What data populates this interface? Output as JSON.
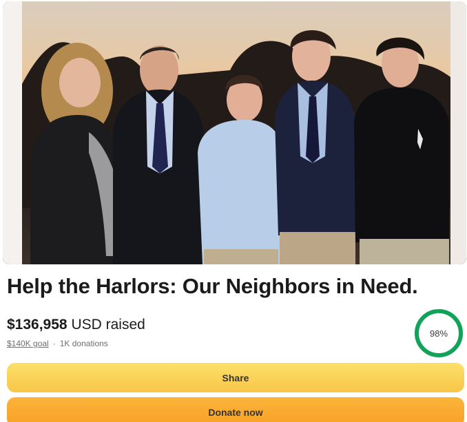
{
  "campaign": {
    "title": "Help the Harlors: Our Neighbors in Need.",
    "raised_amount": "$136,958",
    "raised_unit": "USD raised",
    "goal": "$140K goal",
    "separator": "·",
    "donations": "1K donations",
    "progress_label": "98%",
    "progress_fraction": 0.98
  },
  "buttons": {
    "share_label": "Share",
    "donate_label": "Donate now"
  },
  "colors": {
    "progress": "#12a35a",
    "share_button": "#fbd35a",
    "donate_button": "#f9ab2e"
  }
}
